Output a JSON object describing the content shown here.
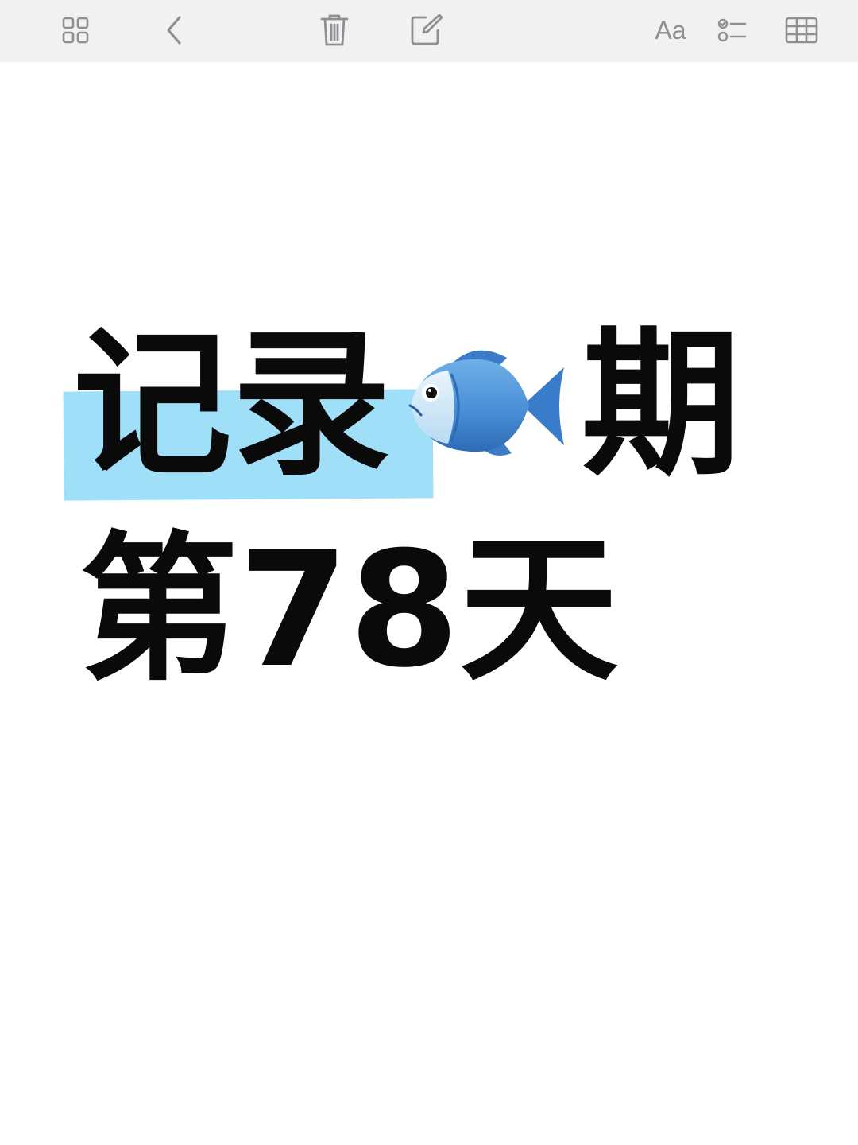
{
  "toolbar": {
    "items": [
      {
        "name": "gallery-view-icon"
      },
      {
        "name": "back-chevron-icon"
      },
      {
        "name": "trash-icon"
      },
      {
        "name": "compose-icon"
      },
      {
        "name": "format-text-button",
        "label": "Aa"
      },
      {
        "name": "checklist-icon"
      },
      {
        "name": "table-icon"
      }
    ],
    "format_label": "Aa"
  },
  "note": {
    "line1_part1": "记录",
    "line1_part2": "期",
    "line2": "第78天",
    "emoji": "fish-icon"
  },
  "colors": {
    "toolbar_bg": "#f1f1f1",
    "icon": "#8e8e93",
    "highlight": "#9fe0f8",
    "text": "#0a0a0a"
  }
}
